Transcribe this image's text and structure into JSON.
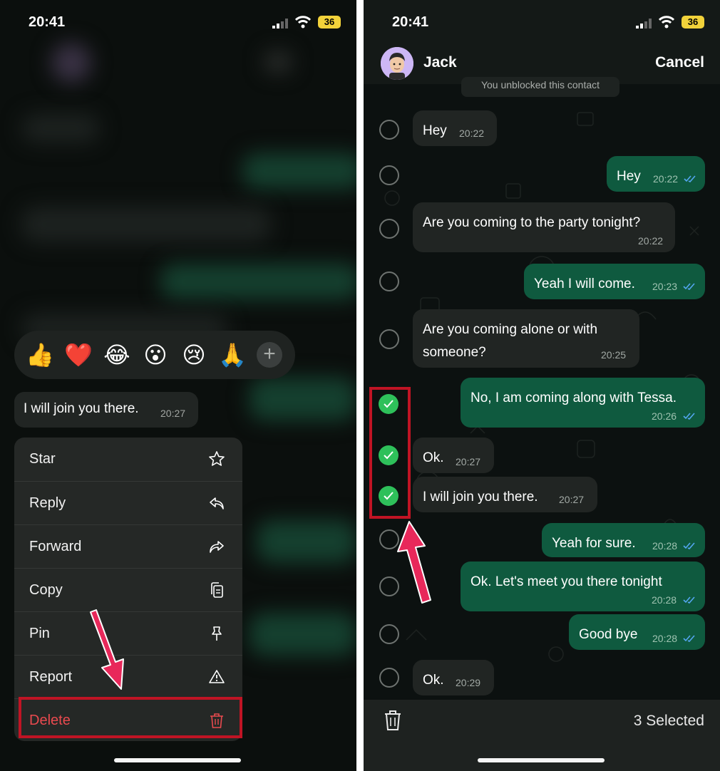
{
  "left": {
    "status": {
      "time": "20:41",
      "battery": "36"
    },
    "reactions": [
      "👍",
      "❤️",
      "😂",
      "😮",
      "😢",
      "🙏"
    ],
    "reaction_more": "+",
    "selected_message": {
      "text": "I will join you there.",
      "time": "20:27"
    },
    "menu": [
      {
        "label": "Star",
        "icon": "star-icon"
      },
      {
        "label": "Reply",
        "icon": "reply-icon"
      },
      {
        "label": "Forward",
        "icon": "forward-icon"
      },
      {
        "label": "Copy",
        "icon": "copy-icon"
      },
      {
        "label": "Pin",
        "icon": "pin-icon"
      },
      {
        "label": "Report",
        "icon": "warning-icon"
      },
      {
        "label": "Delete",
        "icon": "trash-icon"
      }
    ]
  },
  "right": {
    "status": {
      "time": "20:41",
      "battery": "36"
    },
    "contact_name": "Jack",
    "cancel_label": "Cancel",
    "notice": "You unblocked this contact",
    "messages": [
      {
        "text": "Hey",
        "time": "20:22",
        "direction": "in",
        "selected": false
      },
      {
        "text": "Hey",
        "time": "20:22",
        "direction": "out",
        "selected": false
      },
      {
        "text": "Are you coming to the party tonight?",
        "time": "20:22",
        "direction": "in",
        "selected": false
      },
      {
        "text": "Yeah I will come.",
        "time": "20:23",
        "direction": "out",
        "selected": false
      },
      {
        "text": "Are you coming alone or with someone?",
        "time": "20:25",
        "direction": "in",
        "selected": false
      },
      {
        "text": "No, I am coming along with Tessa.",
        "time": "20:26",
        "direction": "out",
        "selected": true
      },
      {
        "text": "Ok.",
        "time": "20:27",
        "direction": "in",
        "selected": true
      },
      {
        "text": "I will join you there.",
        "time": "20:27",
        "direction": "in",
        "selected": true
      },
      {
        "text": "Yeah for sure.",
        "time": "20:28",
        "direction": "out",
        "selected": false
      },
      {
        "text": "Ok. Let's meet you there tonight",
        "time": "20:28",
        "direction": "out",
        "selected": false
      },
      {
        "text": "Good bye",
        "time": "20:28",
        "direction": "out",
        "selected": false
      },
      {
        "text": "Ok.",
        "time": "20:29",
        "direction": "in",
        "selected": false
      }
    ],
    "selected_count": "3 Selected"
  },
  "colors": {
    "accent_green": "#2ec05a",
    "out_bubble": "#0f5a3f",
    "delete_red": "#ea4a4f",
    "highlight_red": "#c01424",
    "arrow_pink": "#e8285a"
  }
}
